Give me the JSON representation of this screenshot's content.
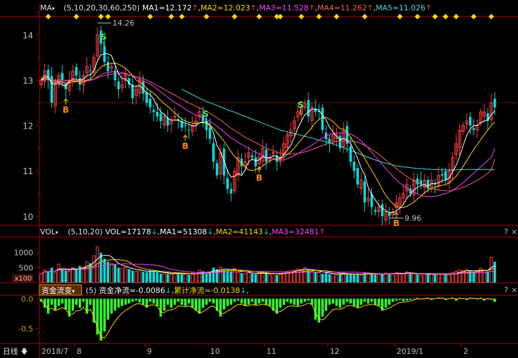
{
  "colors": {
    "up": "#ff3d3d",
    "down": "#00e0e0",
    "frame": "#b00000",
    "text": "#c0c0c0",
    "ma1": "#ffffff",
    "ma2": "#ffd700",
    "ma3": "#ff40ff",
    "ma4": "#ff6060",
    "ma5": "#40e0e0",
    "flow": "#ffd700",
    "flow_up": "#ff3030",
    "flow_down": "#30ff30",
    "diamond": "#ffd700"
  },
  "header": {
    "main_name": "MA",
    "main_params": "(5,10,20,30,60,250)",
    "ma1": "MA1=12.172",
    "ma2": "MA2=12.023",
    "ma3": "MA3=11.528",
    "ma4": "MA4=11.262",
    "ma5": "MA5=11.026",
    "vol_name": "VOL",
    "vol_params": "(5,10,20)",
    "vol_value": "VOL=17178",
    "vol_ma1": "MA1=51308",
    "vol_ma2": "MA2=41143",
    "vol_ma3": "MA3=32481",
    "flow_name": "资金流变",
    "flow_params": "(5)",
    "flow_value": "资金净流=-0.0086",
    "flow_cum": "累计净流=-0.0138",
    "flow_trail": ","
  },
  "panel_buttons": {
    "help": "?",
    "close": "×"
  },
  "footer": {
    "period": "日线",
    "period_arrow": "🡇"
  },
  "chart_data": {
    "type": "candlestick",
    "price_ylim": [
      9.8,
      14.4
    ],
    "price_ticks": [
      "14",
      "13",
      "12",
      "11",
      "10"
    ],
    "annotations": {
      "high": "14.26",
      "low": "9.96"
    },
    "buy_signal": "B",
    "sell_signal": "S",
    "volume_ylim": [
      0,
      1500
    ],
    "volume_ticks": [
      "1000",
      "500"
    ],
    "volume_unit": "x100",
    "flow_ylim": [
      -0.75,
      0.05
    ],
    "flow_ticks": [
      "0.0",
      "-0.5"
    ],
    "x_labels": [
      "2018/7",
      "8",
      "9",
      "10",
      "11",
      "12",
      "2019/1",
      "2"
    ],
    "reference_line": 12.5,
    "bar_count": 130,
    "month_starts": [
      0,
      10,
      30,
      48,
      64,
      82,
      101,
      120
    ],
    "high_bar": 16,
    "low_bar": 99,
    "close": [
      13.0,
      13.2,
      13.0,
      12.5,
      12.9,
      13.1,
      13.0,
      12.8,
      13.0,
      13.2,
      13.1,
      12.9,
      13.1,
      13.3,
      13.2,
      13.5,
      14.0,
      13.8,
      13.4,
      13.2,
      13.3,
      13.0,
      12.8,
      12.9,
      13.1,
      12.9,
      12.6,
      12.8,
      13.0,
      12.7,
      12.5,
      12.4,
      12.3,
      12.2,
      12.1,
      12.2,
      12.0,
      12.1,
      12.2,
      12.1,
      11.95,
      12.0,
      11.9,
      12.0,
      12.1,
      12.3,
      12.1,
      11.9,
      11.7,
      11.2,
      10.9,
      11.4,
      10.9,
      10.6,
      10.5,
      11.0,
      11.3,
      11.1,
      11.2,
      11.4,
      11.3,
      11.1,
      11.3,
      11.5,
      11.2,
      11.3,
      11.4,
      11.2,
      11.3,
      11.6,
      11.8,
      11.9,
      12.1,
      12.3,
      12.4,
      12.5,
      12.2,
      12.4,
      12.3,
      12.3,
      11.9,
      11.7,
      11.6,
      11.8,
      11.8,
      11.5,
      11.9,
      11.6,
      11.2,
      11.0,
      10.7,
      10.8,
      10.3,
      10.4,
      10.2,
      10.1,
      10.2,
      10.0,
      10.1,
      10.0,
      10.1,
      10.3,
      10.4,
      10.5,
      10.7,
      10.5,
      10.8,
      10.7,
      10.7,
      10.8,
      10.6,
      10.8,
      10.7,
      10.9,
      10.9,
      10.8,
      11.0,
      11.3,
      11.6,
      11.9,
      12.0,
      12.1,
      12.0,
      11.9,
      12.0,
      12.3,
      12.3,
      12.1,
      12.5,
      12.4
    ],
    "ma5": [
      13.0,
      13.1,
      13.07,
      12.92,
      12.92,
      12.94,
      12.9,
      12.86,
      12.98,
      13.02,
      13.02,
      13.0,
      13.02,
      13.1,
      13.12,
      13.2,
      13.42,
      13.56,
      13.58,
      13.58,
      13.54,
      13.34,
      13.14,
      13.04,
      13.02,
      12.94,
      12.86,
      12.86,
      12.88,
      12.8,
      12.72,
      12.68,
      12.58,
      12.42,
      12.3,
      12.24,
      12.16,
      12.12,
      12.12,
      12.12,
      12.07,
      12.05,
      12.03,
      11.99,
      11.99,
      12.06,
      12.08,
      12.08,
      12.02,
      11.84,
      11.56,
      11.42,
      11.22,
      11.0,
      10.86,
      10.88,
      10.94,
      10.9,
      11.02,
      11.2,
      11.26,
      11.22,
      11.24,
      11.32,
      11.28,
      11.28,
      11.34,
      11.32,
      11.28,
      11.36,
      11.46,
      11.56,
      11.74,
      11.94,
      12.1,
      12.24,
      12.3,
      12.36,
      12.36,
      12.34,
      12.22,
      12.12,
      11.96,
      11.86,
      11.76,
      11.68,
      11.72,
      11.68,
      11.6,
      11.44,
      11.28,
      11.06,
      10.92,
      10.64,
      10.48,
      10.36,
      10.24,
      10.18,
      10.12,
      10.08,
      10.08,
      10.12,
      10.18,
      10.26,
      10.4,
      10.48,
      10.58,
      10.64,
      10.68,
      10.7,
      10.66,
      10.72,
      10.72,
      10.74,
      10.78,
      10.8,
      10.84,
      10.98,
      11.12,
      11.32,
      11.56,
      11.78,
      11.92,
      12.0,
      12.0,
      12.06,
      12.1,
      12.12,
      12.24,
      12.32
    ],
    "ma10": [
      13.0,
      13.05,
      13.05,
      12.96,
      12.95,
      12.97,
      12.95,
      12.91,
      12.94,
      12.97,
      12.98,
      12.95,
      12.96,
      13.0,
      13.02,
      13.1,
      13.2,
      13.29,
      13.33,
      13.35,
      13.37,
      13.38,
      13.35,
      13.31,
      13.26,
      13.18,
      13.1,
      13.0,
      12.96,
      12.91,
      12.82,
      12.76,
      12.71,
      12.64,
      12.55,
      12.48,
      12.42,
      12.35,
      12.27,
      12.21,
      12.14,
      12.1,
      12.07,
      12.05,
      12.05,
      12.06,
      12.06,
      12.04,
      12.0,
      11.94,
      11.84,
      11.75,
      11.65,
      11.54,
      11.42,
      11.32,
      11.24,
      11.16,
      11.09,
      11.02,
      11.01,
      11.03,
      11.05,
      11.11,
      11.17,
      11.22,
      11.25,
      11.26,
      11.27,
      11.31,
      11.36,
      11.42,
      11.5,
      11.6,
      11.69,
      11.78,
      11.87,
      11.96,
      12.06,
      12.13,
      12.18,
      12.18,
      12.14,
      12.08,
      12.01,
      11.93,
      11.92,
      11.84,
      11.74,
      11.62,
      11.5,
      11.4,
      11.28,
      11.14,
      11.01,
      10.88,
      10.74,
      10.59,
      10.46,
      10.36,
      10.28,
      10.22,
      10.19,
      10.19,
      10.22,
      10.26,
      10.31,
      10.38,
      10.44,
      10.52,
      10.57,
      10.62,
      10.64,
      10.66,
      10.68,
      10.7,
      10.73,
      10.8,
      10.88,
      10.98,
      11.1,
      11.22,
      11.35,
      11.47,
      11.58,
      11.69,
      11.8,
      11.9,
      12.0,
      12.08
    ],
    "ma20": [
      13.0,
      13.03,
      13.05,
      13.0,
      12.98,
      12.98,
      12.97,
      12.95,
      12.95,
      12.96,
      12.96,
      12.96,
      12.96,
      12.98,
      12.99,
      13.02,
      13.07,
      13.12,
      13.15,
      13.17,
      13.18,
      13.19,
      13.18,
      13.17,
      13.15,
      13.12,
      13.09,
      13.05,
      13.02,
      12.99,
      12.95,
      12.91,
      12.86,
      12.8,
      12.74,
      12.68,
      12.62,
      12.56,
      12.51,
      12.46,
      12.41,
      12.36,
      12.31,
      12.27,
      12.23,
      12.2,
      12.17,
      12.13,
      12.09,
      12.04,
      11.98,
      11.92,
      11.86,
      11.79,
      11.73,
      11.68,
      11.63,
      11.58,
      11.54,
      11.5,
      11.45,
      11.41,
      11.37,
      11.34,
      11.31,
      11.29,
      11.27,
      11.25,
      11.24,
      11.25,
      11.27,
      11.3,
      11.34,
      11.38,
      11.43,
      11.48,
      11.52,
      11.57,
      11.62,
      11.68,
      11.73,
      11.77,
      11.8,
      11.82,
      11.84,
      11.84,
      11.84,
      11.83,
      11.81,
      11.77,
      11.72,
      11.66,
      11.58,
      11.5,
      11.41,
      11.32,
      11.23,
      11.14,
      11.05,
      10.96,
      10.88,
      10.8,
      10.73,
      10.67,
      10.62,
      10.57,
      10.53,
      10.49,
      10.46,
      10.44,
      10.43,
      10.43,
      10.44,
      10.46,
      10.48,
      10.5,
      10.53,
      10.57,
      10.62,
      10.68,
      10.74,
      10.81,
      10.88,
      10.95,
      11.02,
      11.09,
      11.16,
      11.23,
      11.3,
      11.5
    ],
    "ma30": [
      13.0,
      13.01,
      13.02,
      13.01,
      13.0,
      13.0,
      13.0,
      12.99,
      12.99,
      12.99,
      12.99,
      12.99,
      12.99,
      13.0,
      13.01,
      13.02,
      13.05,
      13.08,
      13.1,
      13.12,
      13.13,
      13.14,
      13.14,
      13.14,
      13.13,
      13.12,
      13.1,
      13.08,
      13.06,
      13.03,
      13.0,
      12.96,
      12.92,
      12.88,
      12.84,
      12.8,
      12.75,
      12.71,
      12.67,
      12.63,
      12.58,
      12.54,
      12.5,
      12.46,
      12.42,
      12.39,
      12.35,
      12.31,
      12.27,
      12.22,
      12.17,
      12.12,
      12.06,
      12.0,
      11.94,
      11.89,
      11.84,
      11.79,
      11.74,
      11.7,
      11.66,
      11.62,
      11.58,
      11.54,
      11.5,
      11.47,
      11.44,
      11.41,
      11.39,
      11.38,
      11.37,
      11.37,
      11.37,
      11.38,
      11.4,
      11.42,
      11.44,
      11.47,
      11.5,
      11.53,
      11.56,
      11.59,
      11.61,
      11.63,
      11.65,
      11.66,
      11.67,
      11.67,
      11.66,
      11.65,
      11.63,
      11.6,
      11.56,
      11.52,
      11.47,
      11.42,
      11.36,
      11.3,
      11.24,
      11.18,
      11.11,
      11.05,
      10.99,
      10.93,
      10.88,
      10.83,
      10.78,
      10.74,
      10.7,
      10.66,
      10.63,
      10.61,
      10.59,
      10.58,
      10.57,
      10.56,
      10.56,
      10.57,
      10.59,
      10.61,
      10.64,
      10.67,
      10.71,
      10.75,
      10.79,
      10.84,
      10.89,
      10.95,
      11.02,
      11.26
    ],
    "ma60": [
      null,
      null,
      null,
      null,
      null,
      null,
      null,
      null,
      null,
      null,
      null,
      null,
      null,
      null,
      null,
      null,
      null,
      null,
      null,
      null,
      null,
      null,
      null,
      null,
      null,
      null,
      null,
      null,
      null,
      null,
      null,
      null,
      null,
      null,
      null,
      null,
      null,
      null,
      null,
      null,
      12.8,
      12.76,
      12.72,
      12.68,
      12.64,
      12.6,
      12.56,
      12.53,
      12.5,
      12.47,
      12.44,
      12.41,
      12.38,
      12.35,
      12.32,
      12.29,
      12.26,
      12.23,
      12.2,
      12.17,
      12.14,
      12.11,
      12.08,
      12.05,
      12.02,
      11.99,
      11.96,
      11.93,
      11.9,
      11.88,
      11.86,
      11.84,
      11.82,
      11.8,
      11.78,
      11.76,
      11.74,
      11.72,
      11.7,
      11.68,
      11.66,
      11.64,
      11.62,
      11.6,
      11.57,
      11.54,
      11.51,
      11.48,
      11.45,
      11.42,
      11.39,
      11.36,
      11.33,
      11.3,
      11.27,
      11.24,
      11.21,
      11.19,
      11.17,
      11.15,
      11.13,
      11.11,
      11.1,
      11.09,
      11.08,
      11.07,
      11.06,
      11.05,
      11.05,
      11.04,
      11.04,
      11.03,
      11.03,
      11.03,
      11.02,
      11.02,
      11.02,
      11.02,
      11.02,
      11.03,
      11.03,
      11.03,
      11.03,
      11.03,
      11.03,
      11.03,
      11.03,
      11.03,
      11.03,
      11.03
    ],
    "volume": [
      300,
      420,
      380,
      500,
      350,
      620,
      450,
      400,
      380,
      500,
      480,
      560,
      520,
      700,
      650,
      900,
      1200,
      1000,
      800,
      700,
      650,
      600,
      500,
      480,
      520,
      450,
      400,
      380,
      420,
      360,
      350,
      400,
      380,
      340,
      300,
      320,
      300,
      280,
      340,
      300,
      280,
      300,
      260,
      320,
      300,
      420,
      380,
      300,
      360,
      500,
      450,
      520,
      420,
      400,
      380,
      480,
      350,
      320,
      300,
      340,
      300,
      280,
      320,
      360,
      300,
      280,
      300,
      260,
      300,
      360,
      380,
      400,
      420,
      460,
      440,
      500,
      420,
      380,
      360,
      340,
      300,
      320,
      280,
      300,
      260,
      280,
      320,
      260,
      300,
      280,
      300,
      260,
      320,
      300,
      280,
      260,
      300,
      280,
      320,
      300,
      300,
      340,
      320,
      300,
      360,
      320,
      300,
      280,
      260,
      300,
      280,
      300,
      260,
      300,
      280,
      260,
      300,
      340,
      380,
      420,
      400,
      440,
      380,
      360,
      400,
      480,
      420,
      380,
      850,
      700
    ],
    "flow": [
      -0.05,
      -0.15,
      -0.25,
      -0.1,
      -0.2,
      -0.12,
      -0.08,
      -0.18,
      -0.3,
      -0.2,
      -0.1,
      -0.15,
      -0.05,
      -0.25,
      -0.1,
      -0.4,
      -0.6,
      -0.7,
      -0.55,
      -0.35,
      -0.25,
      -0.2,
      -0.15,
      -0.12,
      -0.1,
      -0.08,
      -0.05,
      -0.03,
      -0.06,
      -0.1,
      -0.15,
      -0.05,
      -0.08,
      -0.12,
      -0.3,
      -0.2,
      -0.1,
      -0.15,
      -0.1,
      -0.05,
      -0.1,
      -0.12,
      -0.08,
      -0.15,
      -0.2,
      -0.25,
      -0.15,
      -0.1,
      -0.05,
      -0.08,
      -0.2,
      -0.3,
      -0.18,
      -0.12,
      -0.1,
      -0.05,
      -0.03,
      -0.08,
      -0.12,
      -0.1,
      -0.05,
      -0.1,
      -0.08,
      -0.05,
      -0.1,
      -0.12,
      -0.2,
      -0.25,
      -0.15,
      -0.1,
      -0.05,
      -0.08,
      -0.1,
      -0.12,
      -0.08,
      -0.05,
      -0.03,
      -0.1,
      -0.35,
      -0.4,
      -0.3,
      -0.2,
      -0.1,
      -0.08,
      -0.12,
      -0.15,
      -0.1,
      -0.05,
      -0.08,
      -0.12,
      -0.15,
      -0.1,
      -0.05,
      -0.08,
      -0.05,
      -0.1,
      -0.12,
      -0.2,
      -0.15,
      -0.1,
      -0.05,
      -0.03,
      -0.02,
      -0.04,
      -0.03,
      -0.02,
      0.01,
      0.02,
      -0.01,
      0.01,
      0.02,
      -0.02,
      0.01,
      0.02,
      0.01,
      -0.02,
      0.01,
      0.02,
      -0.03,
      0.02,
      0.01,
      -0.02,
      0.02,
      0.01,
      -0.01,
      0.02,
      -0.03,
      0.01,
      -0.01,
      -0.05
    ],
    "buy_bars": [
      7,
      41,
      62,
      101
    ],
    "sell_bars": [
      17,
      46,
      73
    ]
  }
}
